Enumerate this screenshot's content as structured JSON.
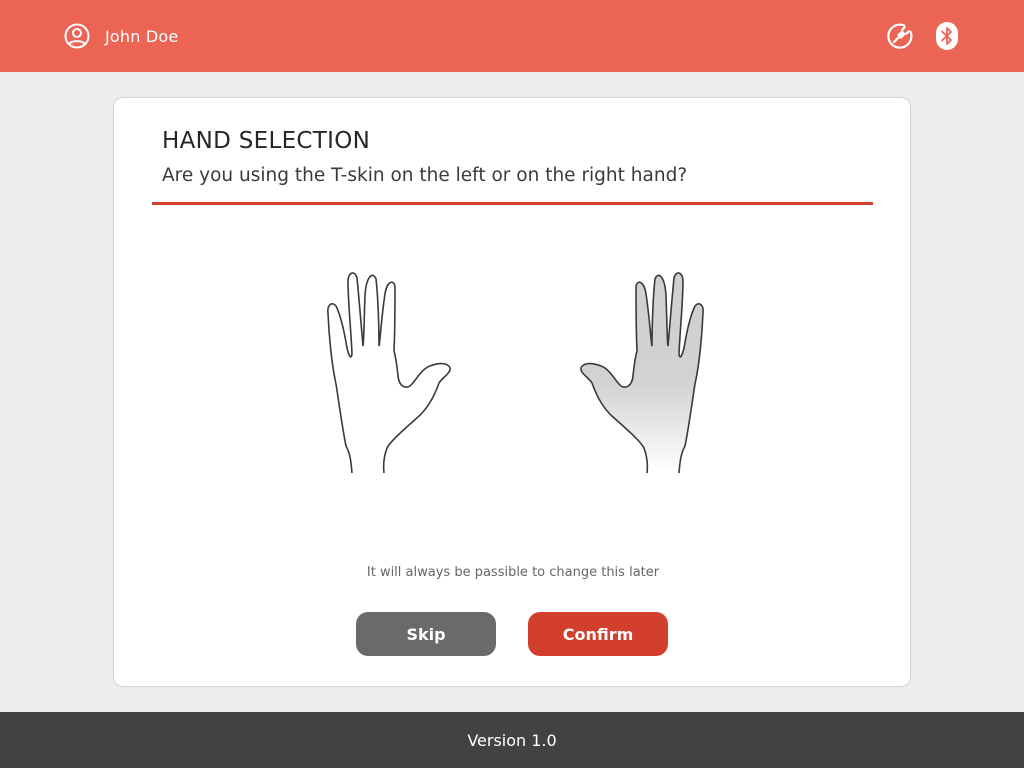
{
  "header": {
    "user_name": "John Doe",
    "avatar_icon": "user-circle-icon",
    "icons": [
      "power-plug-icon",
      "bluetooth-icon"
    ],
    "background_color": "#eb6454"
  },
  "dialog": {
    "title": "HAND SELECTION",
    "question": "Are you using the T-skin on the left or on the right hand?",
    "hands": [
      {
        "side": "left",
        "selected": false
      },
      {
        "side": "right",
        "selected": true
      }
    ],
    "hint": "It will always be passible to change this later",
    "skip_label": "Skip",
    "confirm_label": "Confirm",
    "accent_color": "#d23f2d"
  },
  "footer": {
    "version": "Version 1.0"
  }
}
